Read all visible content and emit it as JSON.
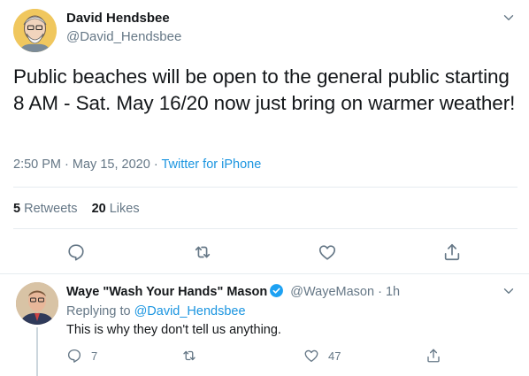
{
  "tweet": {
    "display_name": "David Hendsbee",
    "handle": "@David_Hendsbee",
    "text": "Public beaches will be open to the general public starting 8 AM - Sat. May 16/20 now just bring on warmer weather!",
    "time": "2:50 PM",
    "date": "May 15, 2020",
    "separator": "·",
    "source": "Twitter for iPhone",
    "retweets_count": "5",
    "retweets_label": "Retweets",
    "likes_count": "20",
    "likes_label": "Likes"
  },
  "reply": {
    "display_name": "Waye \"Wash Your Hands\" Mason",
    "handle": "@WayeMason",
    "separator": "·",
    "time": "1h",
    "replying_prefix": "Replying to",
    "replying_to": "@David_Hendsbee",
    "text": "This is why they don't tell us anything.",
    "reply_count": "7",
    "retweet_count": "",
    "like_count": "47"
  },
  "colors": {
    "link": "#1b95e0",
    "secondary_text": "#657786",
    "primary_text": "#14171a",
    "divider": "#e6ecf0",
    "verified": "#1da1f2"
  },
  "icons": [
    "chevron-down-icon",
    "reply-icon",
    "retweet-icon",
    "like-icon",
    "share-icon",
    "verified-badge-icon"
  ]
}
